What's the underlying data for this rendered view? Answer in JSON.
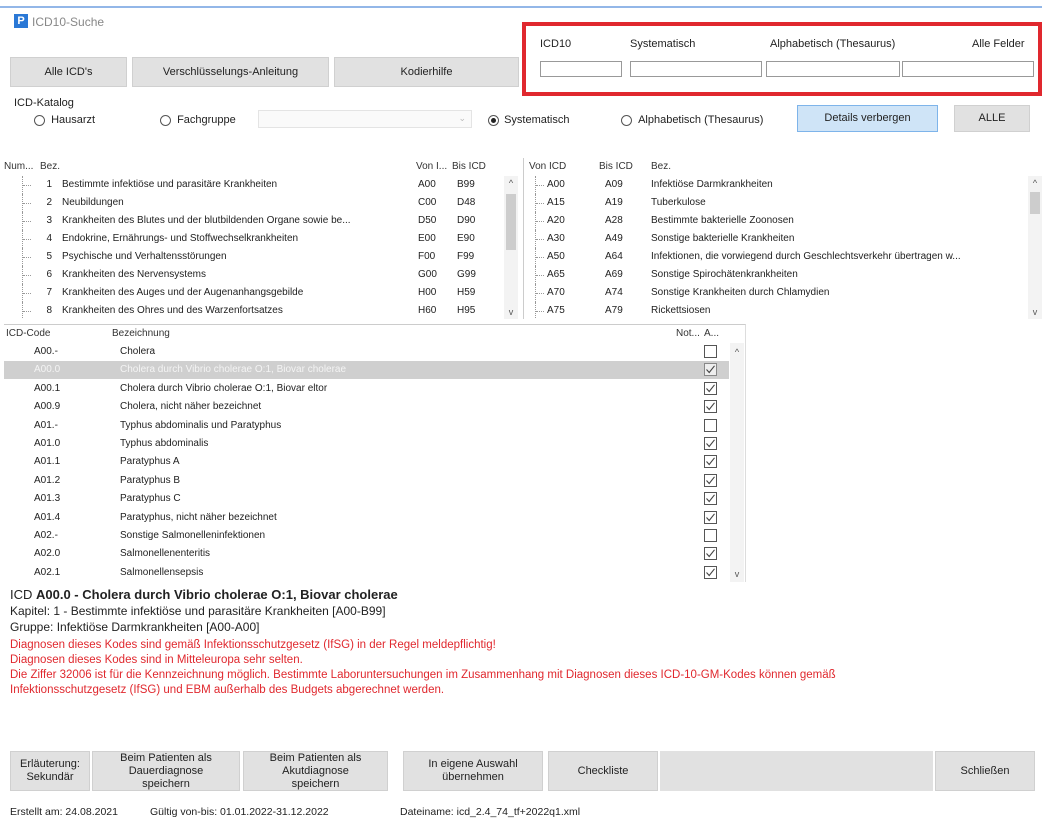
{
  "window": {
    "title": "ICD10-Suche",
    "icon": "P"
  },
  "toolbar": {
    "all_icd": "Alle ICD's",
    "encoding_guide": "Verschlüsselungs-Anleitung",
    "coding_help": "Kodierhilfe"
  },
  "search": {
    "icd10_label": "ICD10",
    "systematic_label": "Systematisch",
    "alphabetic_label": "Alphabetisch (Thesaurus)",
    "all_fields_label": "Alle Felder",
    "icd10_value": "",
    "systematic_value": "",
    "alphabetic_value": "",
    "all_fields_value": "",
    "highlight_color": "#e0282e"
  },
  "catalog": {
    "label": "ICD-Katalog",
    "hausarzt": "Hausarzt",
    "fachgruppe": "Fachgruppe",
    "fachgruppe_value": "",
    "systematisch": "Systematisch",
    "alphabetisch": "Alphabetisch (Thesaurus)",
    "selected": "Systematisch",
    "details_button": "Details verbergen",
    "all_button": "ALLE"
  },
  "chapters": {
    "headers": {
      "num": "Num...",
      "bez": "Bez.",
      "from": "Von I...",
      "to": "Bis ICD"
    },
    "rows": [
      {
        "num": "1",
        "bez": "Bestimmte infektiöse und parasitäre Krankheiten",
        "from": "A00",
        "to": "B99"
      },
      {
        "num": "2",
        "bez": "Neubildungen",
        "from": "C00",
        "to": "D48"
      },
      {
        "num": "3",
        "bez": "Krankheiten des Blutes und der blutbildenden Organe sowie be...",
        "from": "D50",
        "to": "D90"
      },
      {
        "num": "4",
        "bez": "Endokrine, Ernährungs- und Stoffwechselkrankheiten",
        "from": "E00",
        "to": "E90"
      },
      {
        "num": "5",
        "bez": "Psychische und Verhaltensstörungen",
        "from": "F00",
        "to": "F99"
      },
      {
        "num": "6",
        "bez": "Krankheiten des Nervensystems",
        "from": "G00",
        "to": "G99"
      },
      {
        "num": "7",
        "bez": "Krankheiten des Auges und der Augenanhangsgebilde",
        "from": "H00",
        "to": "H59"
      },
      {
        "num": "8",
        "bez": "Krankheiten des Ohres und des Warzenfortsatzes",
        "from": "H60",
        "to": "H95"
      }
    ]
  },
  "groups": {
    "headers": {
      "from": "Von ICD",
      "to": "Bis ICD",
      "bez": "Bez."
    },
    "rows": [
      {
        "from": "A00",
        "to": "A09",
        "bez": "Infektiöse Darmkrankheiten"
      },
      {
        "from": "A15",
        "to": "A19",
        "bez": "Tuberkulose"
      },
      {
        "from": "A20",
        "to": "A28",
        "bez": "Bestimmte bakterielle Zoonosen"
      },
      {
        "from": "A30",
        "to": "A49",
        "bez": "Sonstige bakterielle Krankheiten"
      },
      {
        "from": "A50",
        "to": "A64",
        "bez": "Infektionen, die vorwiegend durch Geschlechtsverkehr übertragen w..."
      },
      {
        "from": "A65",
        "to": "A69",
        "bez": "Sonstige Spirochätenkrankheiten"
      },
      {
        "from": "A70",
        "to": "A74",
        "bez": "Sonstige Krankheiten durch Chlamydien"
      },
      {
        "from": "A75",
        "to": "A79",
        "bez": "Rickettsiosen"
      }
    ]
  },
  "codes": {
    "headers": {
      "code": "ICD-Code",
      "bez": "Bezeichnung",
      "not": "Not...",
      "a": "A..."
    },
    "rows": [
      {
        "code": "A00.-",
        "bez": "Cholera",
        "checked": false,
        "selected": false
      },
      {
        "code": "A00.0",
        "bez": "Cholera durch Vibrio cholerae O:1, Biovar cholerae",
        "checked": true,
        "selected": true
      },
      {
        "code": "A00.1",
        "bez": "Cholera durch Vibrio cholerae O:1, Biovar eltor",
        "checked": true,
        "selected": false
      },
      {
        "code": "A00.9",
        "bez": "Cholera, nicht näher bezeichnet",
        "checked": true,
        "selected": false
      },
      {
        "code": "A01.-",
        "bez": "Typhus abdominalis und Paratyphus",
        "checked": false,
        "selected": false
      },
      {
        "code": "A01.0",
        "bez": "Typhus abdominalis",
        "checked": true,
        "selected": false
      },
      {
        "code": "A01.1",
        "bez": "Paratyphus A",
        "checked": true,
        "selected": false
      },
      {
        "code": "A01.2",
        "bez": "Paratyphus B",
        "checked": true,
        "selected": false
      },
      {
        "code": "A01.3",
        "bez": "Paratyphus C",
        "checked": true,
        "selected": false
      },
      {
        "code": "A01.4",
        "bez": "Paratyphus, nicht näher bezeichnet",
        "checked": true,
        "selected": false
      },
      {
        "code": "A02.-",
        "bez": "Sonstige Salmonelleninfektionen",
        "checked": false,
        "selected": false
      },
      {
        "code": "A02.0",
        "bez": "Salmonellenenteritis",
        "checked": true,
        "selected": false
      },
      {
        "code": "A02.1",
        "bez": "Salmonellensepsis",
        "checked": true,
        "selected": false
      }
    ]
  },
  "details": {
    "icd_prefix": "ICD ",
    "icd_title": "A00.0 - Cholera durch Vibrio cholerae O:1, Biovar cholerae",
    "kapitel": "Kapitel: 1 - Bestimmte infektiöse und parasitäre Krankheiten [A00-B99]",
    "gruppe": "Gruppe: Infektiöse Darmkrankheiten [A00-A00]",
    "warnings": [
      "Diagnosen dieses Kodes sind gemäß Infektionsschutzgesetz (IfSG) in der Regel meldepflichtig!",
      "Diagnosen dieses Kodes sind in Mitteleuropa sehr selten.",
      "Die Ziffer 32006 ist für die Kennzeichnung möglich. Bestimmte Laboruntersuchungen im Zusammenhang mit Diagnosen dieses ICD-10-GM-Kodes können gemäß",
      "Infektionsschutzgesetz (IfSG) und EBM außerhalb des Budgets abgerechnet werden."
    ],
    "warning_color": "#e0282e"
  },
  "actions": {
    "erlaeuterung": "Erläuterung: Sekundär",
    "dauer": "Beim Patienten als Dauerdiagnose speichern",
    "akut": "Beim Patienten als Akutdiagnose speichern",
    "eigene": "In eigene Auswahl übernehmen",
    "checkliste": "Checkliste",
    "schliessen": "Schließen"
  },
  "status": {
    "created": "Erstellt am: 24.08.2021",
    "valid": "Gültig von-bis: 01.01.2022-31.12.2022",
    "file": "Dateiname: icd_2.4_74_tf+2022q1.xml"
  }
}
